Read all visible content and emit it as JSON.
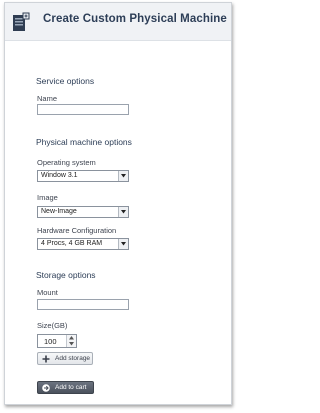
{
  "header": {
    "title": "Create Custom Physical Machine",
    "icon": "machine-icon"
  },
  "service": {
    "section_title": "Service options",
    "name_label": "Name",
    "name_value": ""
  },
  "physical": {
    "section_title": "Physical machine options",
    "os_label": "Operating system",
    "os_value": "Window 3.1",
    "image_label": "Image",
    "image_value": "New-Image",
    "hw_label": "Hardware Configuration",
    "hw_value": "4 Procs, 4 GB RAM"
  },
  "storage": {
    "section_title": "Storage options",
    "mount_label": "Mount",
    "mount_value": "",
    "size_label": "Size(GB)",
    "size_value": "100",
    "add_storage_label": "Add storage"
  },
  "actions": {
    "add_to_cart_label": "Add to cart"
  },
  "colors": {
    "accent": "#2d3e57",
    "header_bg": "#f0f2f5",
    "primary_button": "#555c67"
  }
}
